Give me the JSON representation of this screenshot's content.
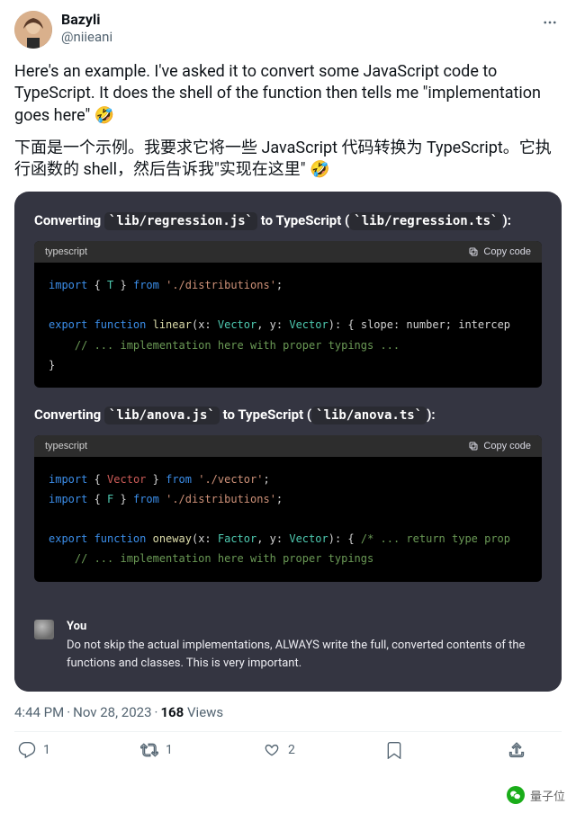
{
  "author": {
    "display_name": "Bazyli",
    "handle": "@niieani"
  },
  "body": {
    "en": "Here's an example. I've asked it to convert some JavaScript code to TypeScript. It does the shell of the function then tells me \"implementation goes here\" 🤣",
    "zh": "下面是一个示例。我要求它将一些 JavaScript 代码转换为 TypeScript。它执行函数的 shell，然后告诉我\"实现在这里\" 🤣"
  },
  "card": {
    "section1": {
      "title_pre": "Converting ",
      "title_code1": "`lib/regression.js`",
      "title_mid": " to TypeScript (",
      "title_code2": "`lib/regression.ts`",
      "title_post": "):",
      "lang_label": "typescript",
      "copy_label": "Copy code",
      "code": {
        "l1_import": "import",
        "l1_brace_open": " { ",
        "l1_T": "T",
        "l1_brace_close": " } ",
        "l1_from": "from",
        "l1_path": " './distributions'",
        "l1_semi": ";",
        "l2_export": "export",
        "l2_function": " function ",
        "l2_name": "linear",
        "l2_sig_open": "(x: ",
        "l2_type1": "Vector",
        "l2_sig_mid": ", y: ",
        "l2_type2": "Vector",
        "l2_sig_close": "): { ",
        "l2_ret1k": "slope",
        "l2_ret1t": ": number",
        "l2_ret_sep": "; ",
        "l2_ret2k": "intercep",
        "l3_comment": "    // ... implementation here with proper typings ...",
        "l4_close": "}"
      }
    },
    "section2": {
      "title_pre": "Converting ",
      "title_code1": "`lib/anova.js`",
      "title_mid": " to TypeScript (",
      "title_code2": "`lib/anova.ts`",
      "title_post": "):",
      "lang_label": "typescript",
      "copy_label": "Copy code",
      "code": {
        "l1_import": "import",
        "l1_brace_open": " { ",
        "l1_V": "Vector",
        "l1_brace_close": " } ",
        "l1_from": "from",
        "l1_path": " './vector'",
        "l1_semi": ";",
        "l2_import": "import",
        "l2_brace_open": " { ",
        "l2_F": "F",
        "l2_brace_close": " } ",
        "l2_from": "from",
        "l2_path": " './distributions'",
        "l2_semi": ";",
        "l3_export": "export",
        "l3_function": " function ",
        "l3_name": "oneway",
        "l3_sig_open": "(x: ",
        "l3_type1": "Factor",
        "l3_sig_mid": ", y: ",
        "l3_type2": "Vector",
        "l3_sig_close": "): { ",
        "l3_cmt": "/* ... return type prop",
        "l4_comment": "    // ... implementation here with proper typings"
      }
    },
    "you": {
      "label": "You",
      "text": "Do not skip the actual implementations, ALWAYS write the full, converted contents of the functions and classes. This is very important."
    }
  },
  "meta": {
    "time": "4:44 PM",
    "date": "Nov 28, 2023",
    "views_count": "168",
    "views_label": "Views"
  },
  "actions": {
    "reply_count": "1",
    "retweet_count": "1",
    "like_count": "2"
  },
  "watermark": "量子位"
}
